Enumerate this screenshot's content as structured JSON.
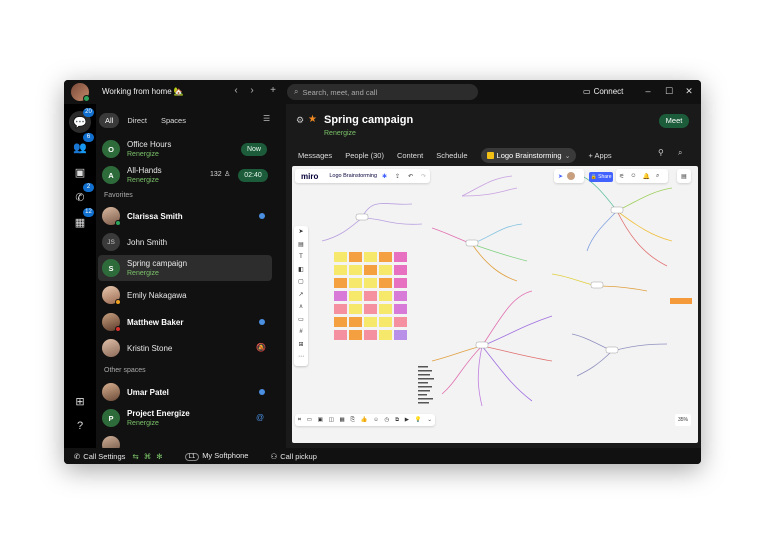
{
  "titlebar": {
    "status": "Working from home 🏡",
    "search_placeholder": "Search, meet, and call",
    "connect_label": "Connect"
  },
  "rail": {
    "messaging_badge": "20",
    "teams_badge": "6",
    "calls_badge": "2",
    "calendar_badge": "12"
  },
  "filters": {
    "all": "All",
    "direct": "Direct",
    "spaces": "Spaces"
  },
  "meetings": [
    {
      "name": "Office Hours",
      "team": "Renergize",
      "initial": "O",
      "pill": "Now"
    },
    {
      "name": "All-Hands",
      "team": "Renergize",
      "initial": "A",
      "count": "132",
      "pill": "02:40"
    }
  ],
  "sections": {
    "favorites": "Favorites",
    "other_spaces": "Other spaces"
  },
  "favorites": [
    {
      "name": "Clarissa Smith",
      "bold": true,
      "unread": true
    },
    {
      "name": "John Smith",
      "initials": "JS"
    },
    {
      "name": "Spring campaign",
      "team": "Renergize",
      "initial": "S",
      "selected": true
    },
    {
      "name": "Emily Nakagawa"
    },
    {
      "name": "Matthew Baker",
      "bold": true,
      "unread": true
    },
    {
      "name": "Kristin Stone",
      "muted": true
    }
  ],
  "other_spaces": [
    {
      "name": "Umar Patel",
      "bold": true,
      "unread": true
    },
    {
      "name": "Project Energize",
      "team": "Renergize",
      "initial": "P",
      "bold": true,
      "mention": true
    }
  ],
  "footer": {
    "call_settings": "Call Settings",
    "line_badge": "L1",
    "softphone": "My Softphone",
    "call_pickup": "Call pickup"
  },
  "space": {
    "title": "Spring campaign",
    "team": "Renergize",
    "meet_label": "Meet",
    "tabs": [
      "Messages",
      "People (30)",
      "Content",
      "Schedule"
    ],
    "active_tab": "Logo Brainstorming",
    "apps_label": "Apps"
  },
  "board": {
    "brand": "miro",
    "name": "Logo Brainstorming",
    "share_label": "Share",
    "zoom": "35%"
  },
  "colors": {
    "accent_green": "#1c5c3a",
    "team_green": "#7bc36a",
    "badge_blue": "#1170cf",
    "miro_yellow": "#f2c014"
  }
}
